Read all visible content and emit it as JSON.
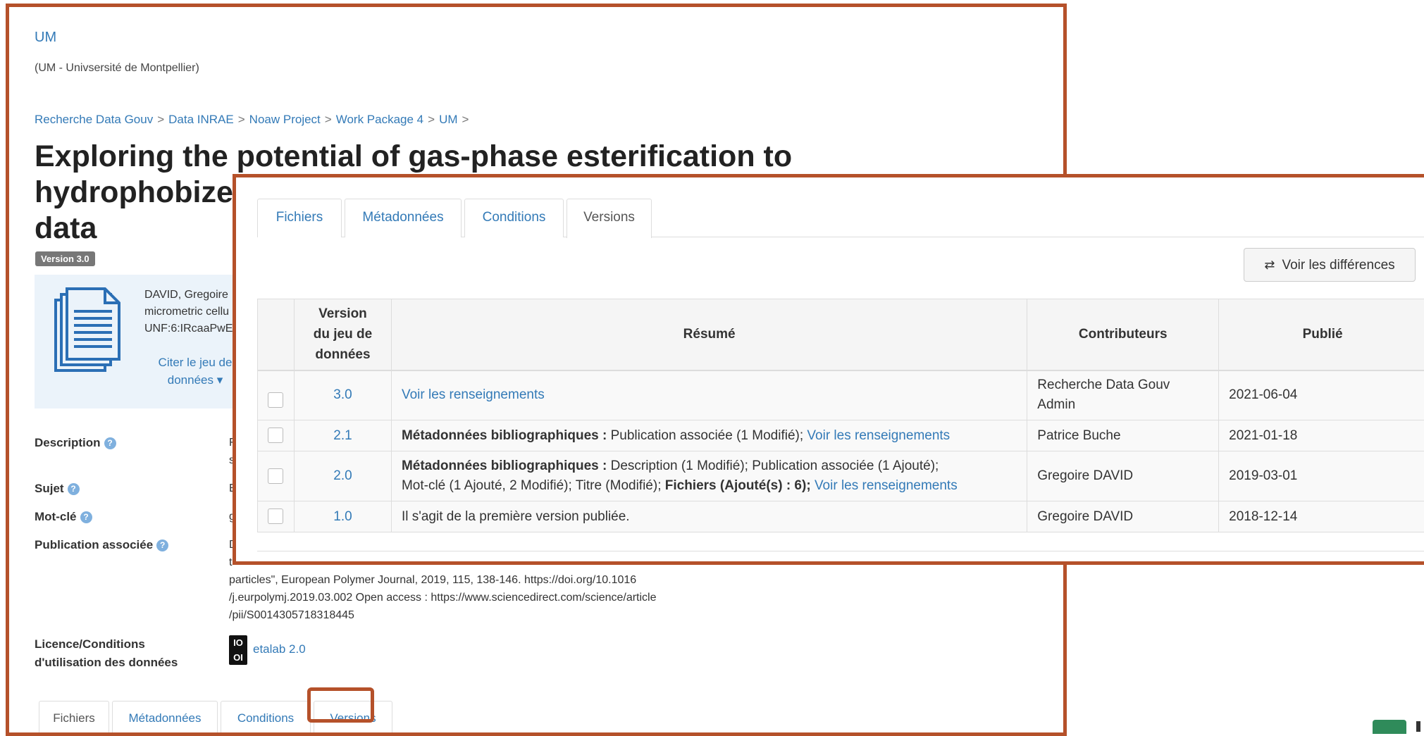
{
  "background_page": {
    "dataverse_name": "UM",
    "dataverse_subtitle": "(UM - Univsersité de Montpellier)",
    "breadcrumb": [
      "Recherche Data Gouv",
      "Data INRAE",
      "Noaw Project",
      "Work Package 4",
      "UM"
    ],
    "breadcrumb_sep": ">",
    "title_line1": "Exploring the potential of gas-phase esterification to",
    "title_line2": "hydrophobize",
    "title_line3": "data",
    "version_badge": "Version 3.0",
    "citation_line1": "DAVID, Gregoire",
    "citation_line2": "micrometric cellu",
    "citation_line3": "UNF:6:IRcaaPwE",
    "cite_button_line1": "Citer le jeu de",
    "cite_button_line2": "données ▾",
    "metadata": {
      "description_label": "Description",
      "description_value_line1": "F",
      "description_value_line2": "s",
      "subject_label": "Sujet",
      "subject_value": "E",
      "keyword_label": "Mot-clé",
      "keyword_value": "g",
      "publication_label": "Publication associée",
      "publication_line1": "D",
      "publication_line2": "t",
      "publication_line3": "particles\", European Polymer Journal, 2019, 115, 138-146. https://doi.org/10.1016",
      "publication_line4": "/j.eurpolymj.2019.03.002 Open access : https://www.sciencedirect.com/science/article",
      "publication_line5": "/pii/S0014305718318445",
      "license_label_line1": "Licence/Conditions",
      "license_label_line2": "d'utilisation des données",
      "license_logo_top": "IO",
      "license_logo_bottom": "OI",
      "license_value": "etalab 2.0"
    },
    "tabs": [
      "Fichiers",
      "Métadonnées",
      "Conditions",
      "Versions"
    ],
    "active_tab": "Fichiers",
    "highlighted_tab": "Versions"
  },
  "overlay": {
    "tabs": [
      "Fichiers",
      "Métadonnées",
      "Conditions",
      "Versions"
    ],
    "active_tab": "Versions",
    "diff_button_icon": "⇄",
    "diff_button_label": "Voir les différences",
    "table": {
      "headers": {
        "version_line1": "Version",
        "version_line2": "du jeu de",
        "version_line3": "données",
        "summary": "Résumé",
        "contributors": "Contributeurs",
        "published": "Publié"
      },
      "rows": [
        {
          "version": "3.0",
          "summary_link": "Voir les renseignements",
          "contributor_line1": "Recherche Data Gouv",
          "contributor_line2": "Admin",
          "published": "2021-06-04"
        },
        {
          "version": "2.1",
          "summary_bold": "Métadonnées bibliographiques :",
          "summary_text": " Publication associée (1 Modifié); ",
          "summary_link": "Voir les renseignements",
          "contributor_line1": "Patrice Buche",
          "published": "2021-01-18"
        },
        {
          "version": "2.0",
          "summary_bold": "Métadonnées bibliographiques :",
          "summary_text": " Description (1 Modifié); Publication associée (1 Ajouté);",
          "summary_text2": "Mot-clé (1 Ajouté, 2 Modifié); Titre (Modifié); ",
          "summary_bold2": "Fichiers (Ajouté(s) : 6);",
          "summary_link": "Voir les renseignements",
          "contributor_line1": "Gregoire DAVID",
          "published": "2019-03-01"
        },
        {
          "version": "1.0",
          "summary_text": "Il s'agit de la première version publiée.",
          "contributor_line1": "Gregoire DAVID",
          "published": "2018-12-14"
        }
      ]
    }
  },
  "colors": {
    "highlight_frame": "#b5512a",
    "link": "#337ab7",
    "citation_bg": "#ebf3fa",
    "badge_bg": "#777777"
  }
}
